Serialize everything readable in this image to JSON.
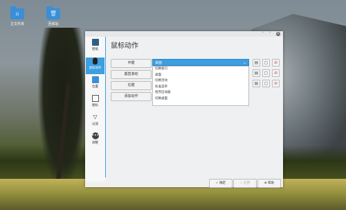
{
  "desktop": {
    "icons": [
      {
        "label": "主文件夹",
        "icon": "home-icon"
      },
      {
        "label": "回收站",
        "icon": "trash-icon"
      }
    ]
  },
  "window": {
    "heading": "鼠标动作",
    "sidebar": [
      {
        "label": "壁纸",
        "icon": "wallpaper-icon"
      },
      {
        "label": "鼠标动作",
        "icon": "mouse-icon",
        "active": true
      },
      {
        "label": "位置",
        "icon": "folder-icon"
      },
      {
        "label": "图标",
        "icon": "icons-icon"
      },
      {
        "label": "过滤",
        "icon": "filter-icon"
      },
      {
        "label": "调整",
        "icon": "tweaks-icon"
      }
    ],
    "actions": [
      "中键",
      "垂直滚动",
      "右键",
      "添加动作"
    ],
    "dropdown": {
      "selected": "桌面",
      "options": [
        "切换窗口",
        "桌面",
        "切换活动",
        "标准菜单",
        "程序启动器",
        "切换桌面"
      ]
    },
    "footer": {
      "ok": "确定",
      "apply": "应用",
      "help": "帮助"
    }
  },
  "colors": {
    "accent": "#3d9ee0",
    "window_bg": "#eff0f1"
  }
}
